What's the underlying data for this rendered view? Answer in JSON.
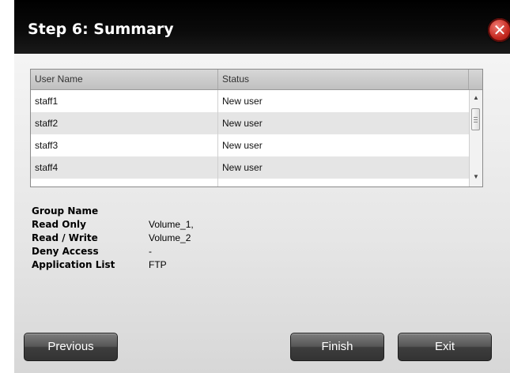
{
  "dialog": {
    "title": "Step 6: Summary",
    "close_icon": "close-icon",
    "close_glyph": "✕"
  },
  "users_table": {
    "columns": [
      "User Name",
      "Status"
    ],
    "rows": [
      {
        "user_name": "staff1",
        "status": "New user"
      },
      {
        "user_name": "staff2",
        "status": "New user"
      },
      {
        "user_name": "staff3",
        "status": "New user"
      },
      {
        "user_name": "staff4",
        "status": "New user"
      }
    ],
    "scroll_up_glyph": "▲",
    "scroll_down_glyph": "▼"
  },
  "summary": {
    "group_name_label": "Group Name",
    "group_name_value": "",
    "read_only_label": "Read Only",
    "read_only_value": "Volume_1,",
    "read_write_label": "Read / Write",
    "read_write_value": "Volume_2",
    "deny_access_label": "Deny Access",
    "deny_access_value": "-",
    "application_list_label": "Application List",
    "application_list_value": "FTP"
  },
  "buttons": {
    "previous": "Previous",
    "finish": "Finish",
    "exit": "Exit"
  },
  "colors": {
    "titlebar": "#000000",
    "close_button": "#c4281f",
    "button_dark": "#444444"
  }
}
